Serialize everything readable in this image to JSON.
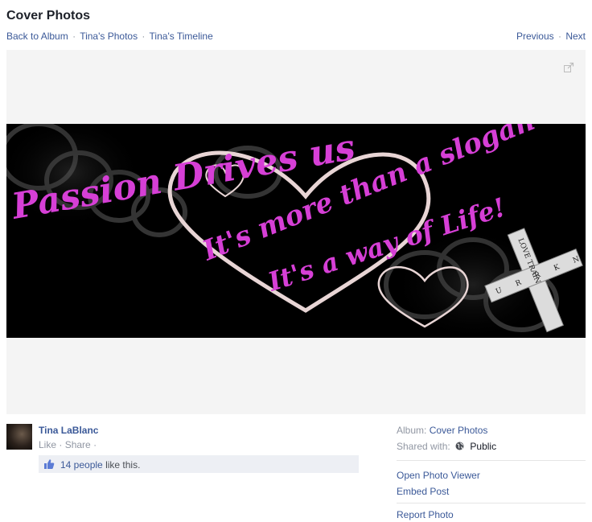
{
  "header": {
    "title": "Cover Photos",
    "breadcrumbs": [
      "Back to Album",
      "Tina's Photos",
      "Tina's Timeline"
    ],
    "separator": "·",
    "pager": {
      "previous": "Previous",
      "next": "Next"
    }
  },
  "photo": {
    "line1": "Passion Drives us",
    "line2": "It's more than a slogan",
    "line3": "It's a way of Life!",
    "line4": "It's a way of Life!",
    "cross_vertical": "LOVE TRAIN",
    "cross_horizontal": "U R R K N",
    "text_color": "#d63fd6"
  },
  "author": {
    "name": "Tina LaBlanc",
    "like_label": "Like",
    "share_label": "Share",
    "separator": "·",
    "likes_count": "14 people",
    "likes_suffix": "like this."
  },
  "meta": {
    "album_label": "Album:",
    "album_value": "Cover Photos",
    "shared_label": "Shared with:",
    "shared_value": "Public",
    "open_viewer": "Open Photo Viewer",
    "embed_post": "Embed Post",
    "report_photo": "Report Photo"
  },
  "icons": {
    "expand": "expand-icon",
    "thumbs_up": "thumbs-up-icon",
    "globe": "globe-icon"
  },
  "colors": {
    "link": "#3b5998",
    "muted": "#9197a3",
    "stage_bg": "#f4f4f4",
    "likes_bg": "#edeff4"
  }
}
